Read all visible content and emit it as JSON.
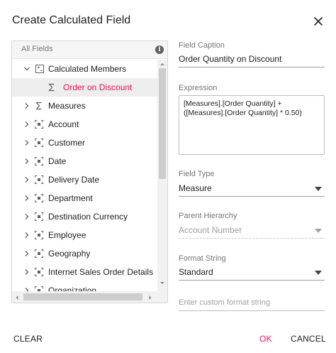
{
  "dialog": {
    "title": "Create Calculated Field"
  },
  "tree": {
    "header_label": "All Fields",
    "items": [
      {
        "label": "Calculated Members",
        "icon": "calc-icon",
        "expanded": true
      },
      {
        "label": "Order on Discount",
        "icon": "sigma-icon",
        "selected": true
      },
      {
        "label": "Measures",
        "icon": "sigma-icon"
      },
      {
        "label": "Account",
        "icon": "dimension-icon"
      },
      {
        "label": "Customer",
        "icon": "dimension-icon"
      },
      {
        "label": "Date",
        "icon": "dimension-icon"
      },
      {
        "label": "Delivery Date",
        "icon": "dimension-icon"
      },
      {
        "label": "Department",
        "icon": "dimension-icon"
      },
      {
        "label": "Destination Currency",
        "icon": "dimension-icon"
      },
      {
        "label": "Employee",
        "icon": "dimension-icon"
      },
      {
        "label": "Geography",
        "icon": "dimension-icon"
      },
      {
        "label": "Internet Sales Order Details",
        "icon": "dimension-icon"
      },
      {
        "label": "Organization",
        "icon": "dimension-icon"
      }
    ]
  },
  "form": {
    "caption_label": "Field Caption",
    "caption_value": "Order Quantity on Discount",
    "expression_label": "Expression",
    "expression_value": "[Measures].[Order Quantity] +\n([Measures].[Order Quantity] * 0.50)",
    "field_type_label": "Field Type",
    "field_type_value": "Measure",
    "parent_hierarchy_label": "Parent Hierarchy",
    "parent_hierarchy_value": "Account Number",
    "format_string_label": "Format String",
    "format_string_value": "Standard",
    "custom_format_placeholder": "Enter custom format string"
  },
  "footer": {
    "clear_label": "CLEAR",
    "ok_label": "OK",
    "cancel_label": "CANCEL"
  },
  "colors": {
    "accent": "#e3165b",
    "border": "#d8d8d8"
  }
}
